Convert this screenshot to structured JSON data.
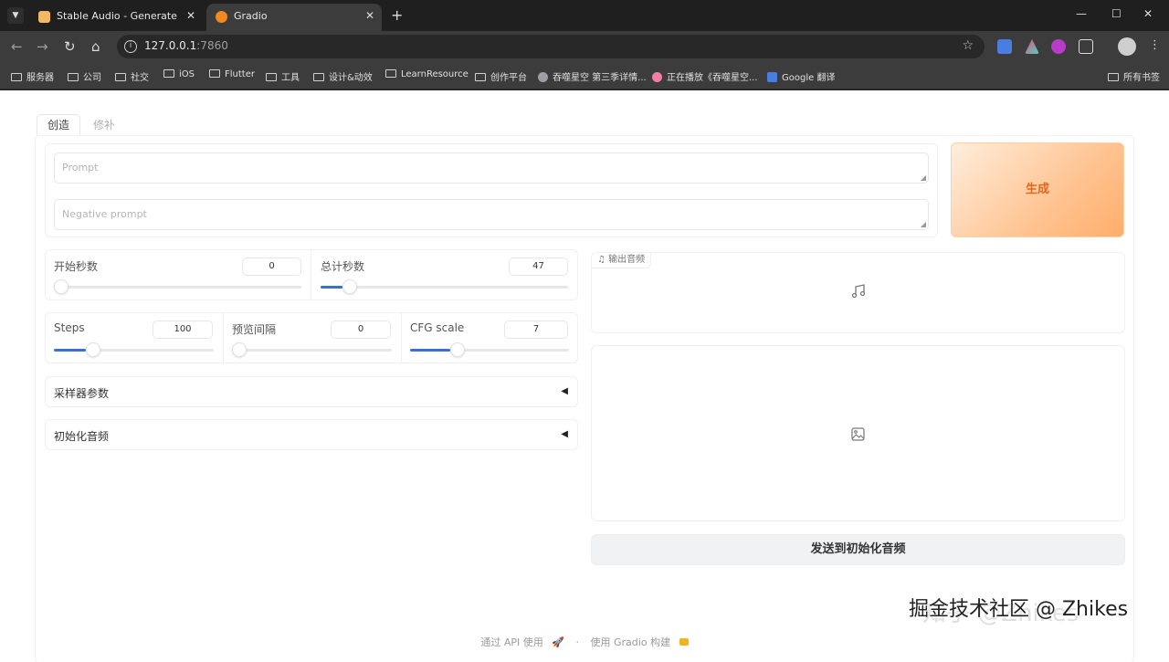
{
  "browser": {
    "tabs": [
      {
        "title": "Stable Audio - Generate",
        "active": false,
        "favicon_color": "#f2b866"
      },
      {
        "title": "Gradio",
        "active": true,
        "favicon_color": "#f08a1e"
      }
    ],
    "new_tab": "+",
    "window_controls": {
      "minimize": "—",
      "maximize": "☐",
      "close": "✕"
    },
    "url_host": "127.0.0.1",
    "url_port": ":7860",
    "bookmarks": [
      {
        "label": "服务器",
        "type": "folder"
      },
      {
        "label": "公司",
        "type": "folder"
      },
      {
        "label": "社交",
        "type": "folder"
      },
      {
        "label": "iOS",
        "type": "folder"
      },
      {
        "label": "Flutter",
        "type": "folder"
      },
      {
        "label": "工具",
        "type": "folder"
      },
      {
        "label": "设计&动效",
        "type": "folder"
      },
      {
        "label": "LearnResource",
        "type": "folder"
      },
      {
        "label": "创作平台",
        "type": "folder"
      },
      {
        "label": "吞噬星空 第三季详情...",
        "type": "globe"
      },
      {
        "label": "正在播放《吞噬星空...",
        "type": "flower"
      },
      {
        "label": "Google 翻译",
        "type": "translate"
      }
    ],
    "all_bookmarks": "所有书签"
  },
  "app": {
    "tabs": [
      "创造",
      "修补"
    ],
    "prompt_placeholder": "Prompt",
    "negative_prompt_placeholder": "Negative prompt",
    "generate_label": "生成",
    "sliders_time": [
      {
        "label": "开始秒数",
        "value": "0",
        "fraction": 0.0
      },
      {
        "label": "总计秒数",
        "value": "47",
        "fraction": 0.09
      }
    ],
    "sliders_params": [
      {
        "label": "Steps",
        "value": "100",
        "fraction": 0.2
      },
      {
        "label": "预览间隔",
        "value": "0",
        "fraction": 0.0
      },
      {
        "label": "CFG scale",
        "value": "7",
        "fraction": 0.25
      }
    ],
    "accordions": [
      {
        "label": "采样器参数",
        "arrow": "◀"
      },
      {
        "label": "初始化音频",
        "arrow": "◀"
      }
    ],
    "output_audio_label": "输出音频",
    "send_button": "发送到初始化音频"
  },
  "footer": {
    "api": "通过 API 使用",
    "separator": "·",
    "built_with": "使用 Gradio 构建"
  },
  "watermark": {
    "text": "掘金技术社区 @ Zhikes",
    "faint_text": "知乎 @Zhikes"
  },
  "colors": {
    "accent_blue": "#3b6fd4",
    "generate_orange": "#e2661a"
  }
}
